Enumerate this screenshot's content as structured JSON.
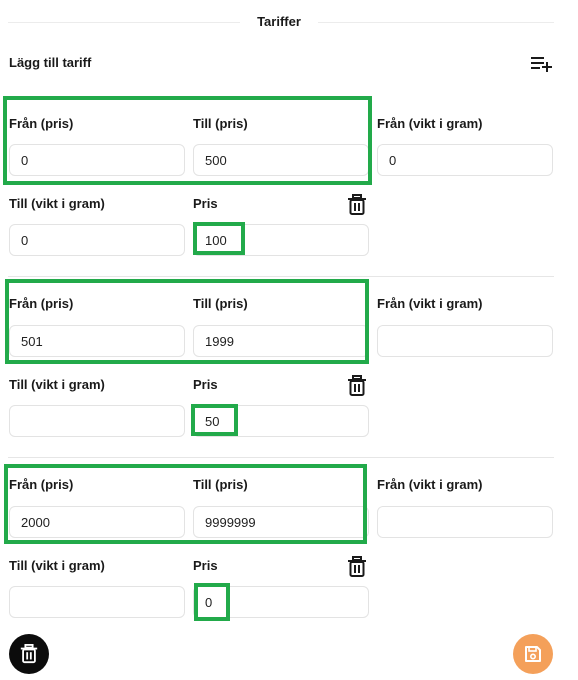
{
  "header": {
    "title": "Tariffer"
  },
  "add_section": {
    "label": "Lägg till tariff",
    "button_icon": "playlist-add-icon"
  },
  "labels": {
    "from_price": "Från (pris)",
    "to_price": "Till (pris)",
    "from_weight": "Från (vikt i gram)",
    "to_weight": "Till (vikt i gram)",
    "price": "Pris"
  },
  "tariffs": [
    {
      "from_price": "0",
      "to_price": "500",
      "from_weight": "0",
      "to_weight": "0",
      "price": "100"
    },
    {
      "from_price": "501",
      "to_price": "1999",
      "from_weight": "",
      "to_weight": "",
      "price": "50"
    },
    {
      "from_price": "2000",
      "to_price": "9999999",
      "from_weight": "",
      "to_weight": "",
      "price": "0"
    }
  ],
  "actions": {
    "delete_icon": "trash-icon",
    "save_icon": "save-icon",
    "delete_color": "#0c0c0c",
    "save_color": "#f4a05a"
  },
  "highlight_color": "#22aa4a"
}
